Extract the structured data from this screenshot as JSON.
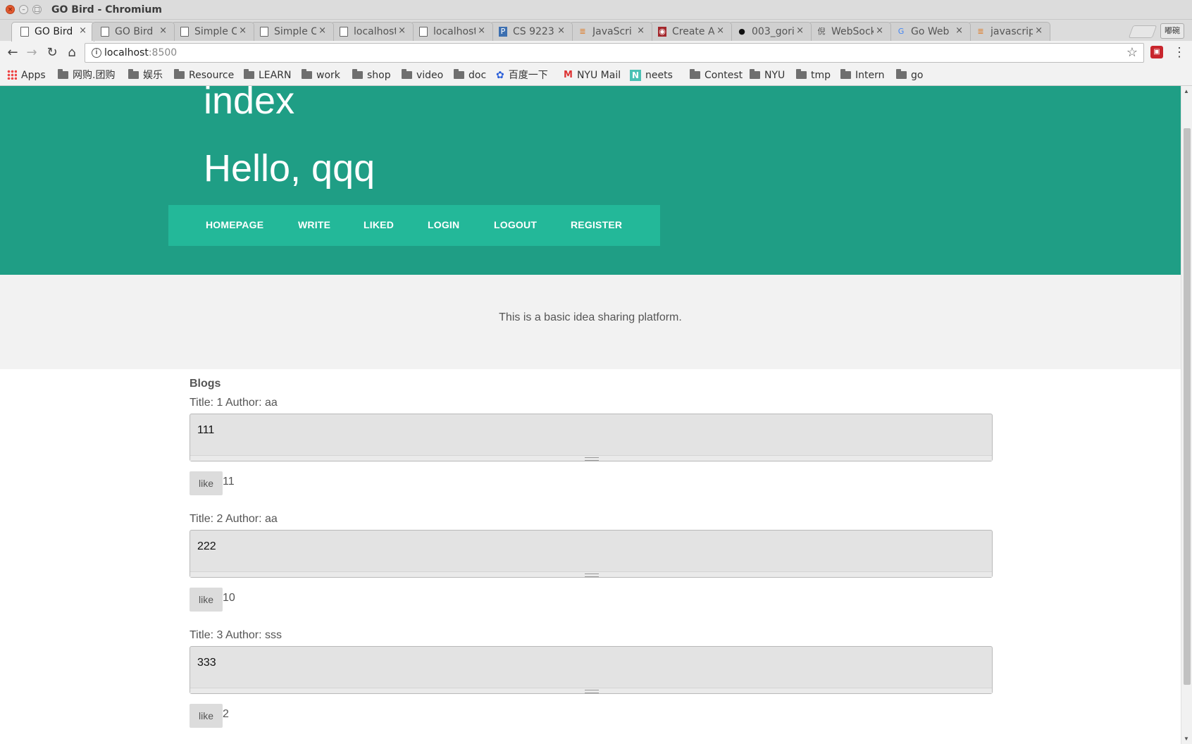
{
  "window": {
    "title": "GO Bird - Chromium"
  },
  "tabs": [
    {
      "title": "GO Bird",
      "icon": "page-icon",
      "active": true
    },
    {
      "title": "GO Bird",
      "icon": "page-icon"
    },
    {
      "title": "Simple C",
      "icon": "page-icon"
    },
    {
      "title": "Simple C",
      "icon": "page-icon"
    },
    {
      "title": "localhost",
      "icon": "page-icon"
    },
    {
      "title": "localhost",
      "icon": "page-icon"
    },
    {
      "title": "CS 9223",
      "icon": "piazza-icon"
    },
    {
      "title": "JavaScri",
      "icon": "stackoverflow-icon"
    },
    {
      "title": "Create A",
      "icon": "eye-icon"
    },
    {
      "title": "003_gori",
      "icon": "github-icon"
    },
    {
      "title": "WebSock",
      "icon": "ni-icon"
    },
    {
      "title": "Go Web I",
      "icon": "google-icon"
    },
    {
      "title": "javascrip",
      "icon": "stackoverflow-icon"
    }
  ],
  "profile_button": "嘟碗",
  "address": {
    "host": "localhost",
    "port": ":8500"
  },
  "bookmarks": [
    {
      "label": "Apps",
      "icon": "apps-icon"
    },
    {
      "label": "网购.团购",
      "icon": "folder-icon"
    },
    {
      "label": "娱乐",
      "icon": "folder-icon"
    },
    {
      "label": "Resource",
      "icon": "folder-icon"
    },
    {
      "label": "LEARN",
      "icon": "folder-icon"
    },
    {
      "label": "work",
      "icon": "folder-icon"
    },
    {
      "label": "shop",
      "icon": "folder-icon"
    },
    {
      "label": "video",
      "icon": "folder-icon"
    },
    {
      "label": "doc",
      "icon": "folder-icon"
    },
    {
      "label": "百度一下",
      "icon": "baidu-icon"
    },
    {
      "label": "NYU Mail",
      "icon": "gmail-icon"
    },
    {
      "label": "neets",
      "icon": "neets-icon"
    },
    {
      "label": "Contest",
      "icon": "folder-icon"
    },
    {
      "label": "NYU",
      "icon": "folder-icon"
    },
    {
      "label": "tmp",
      "icon": "folder-icon"
    },
    {
      "label": "Intern",
      "icon": "folder-icon"
    },
    {
      "label": "go",
      "icon": "folder-icon"
    }
  ],
  "page": {
    "title": "index",
    "greeting": "Hello, qqq",
    "nav": [
      "HOMEPAGE",
      "WRITE",
      "LIKED",
      "LOGIN",
      "LOGOUT",
      "REGISTER"
    ],
    "intro": "This is a basic idea sharing platform.",
    "blogs_heading": "Blogs",
    "like_label": "like",
    "posts": [
      {
        "meta": "Title: 1 Author: aa",
        "body": "111",
        "likes": "11"
      },
      {
        "meta": "Title: 2 Author: aa",
        "body": "222",
        "likes": "10"
      },
      {
        "meta": "Title: 3 Author: sss",
        "body": "333",
        "likes": "2"
      }
    ]
  },
  "colors": {
    "hero": "#1f9e85",
    "navbar": "#23b899",
    "intro_bg": "#f2f2f2"
  }
}
